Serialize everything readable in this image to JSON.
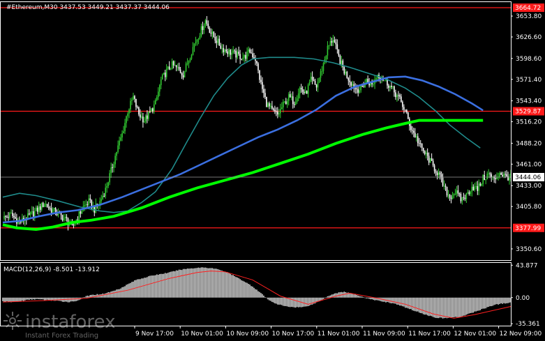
{
  "colors": {
    "background": "#000000",
    "axis": "#ffffff",
    "bull": "#32cd32",
    "bear": "#ffffff",
    "ma_fast": "#1f8b8b",
    "ma_mid": "#3b6fe0",
    "ma_slow": "#00ff00",
    "level": "#ff1a1a",
    "macd_hist": "#c8c8c8",
    "macd_signal": "#ff2020",
    "current_price_bg": "#ffffff",
    "current_price_fg": "#000000"
  },
  "header": {
    "title": "#Ethereum,M30  3437.53 3449.21 3437.37 3444.06"
  },
  "watermark": {
    "logo_icon": "instaforex-logo-icon",
    "brand": "instaforex",
    "tagline": "Instant Forex Trading"
  },
  "chart_data": [
    {
      "type": "candlestick",
      "symbol": "#Ethereum",
      "timeframe": "M30",
      "ohlc_last": {
        "open": 3437.53,
        "high": 3449.21,
        "low": 3437.37,
        "close": 3444.06
      },
      "ylim": [
        3336,
        3672
      ],
      "y_ticks": [
        "3653.80",
        "3626.60",
        "3598.60",
        "3571.40",
        "3543.40",
        "3516.20",
        "3488.20",
        "3461.00",
        "3433.00",
        "3405.80",
        "3350.60"
      ],
      "x_ticks": [
        "9 Nov 17:00",
        "10 Nov 01:00",
        "10 Nov 09:00",
        "10 Nov 17:00",
        "11 Nov 01:00",
        "11 Nov 09:00",
        "11 Nov 17:00",
        "12 Nov 01:00",
        "12 Nov 09:00"
      ],
      "levels": [
        {
          "label": "3664.72",
          "value": 3664.72
        },
        {
          "label": "3529.87",
          "value": 3529.87
        },
        {
          "label": "3377.99",
          "value": 3377.99
        }
      ],
      "current_price": {
        "label": "3444.06",
        "value": 3444.06
      },
      "close_path": [
        [
          0,
          3390
        ],
        [
          6,
          3395
        ],
        [
          12,
          3385
        ],
        [
          18,
          3392
        ],
        [
          24,
          3400
        ],
        [
          30,
          3410
        ],
        [
          34,
          3403
        ],
        [
          40,
          3396
        ],
        [
          46,
          3388
        ],
        [
          50,
          3378
        ],
        [
          54,
          3392
        ],
        [
          58,
          3405
        ],
        [
          62,
          3412
        ],
        [
          66,
          3402
        ],
        [
          70,
          3412
        ],
        [
          74,
          3428
        ],
        [
          78,
          3452
        ],
        [
          82,
          3478
        ],
        [
          86,
          3500
        ],
        [
          90,
          3530
        ],
        [
          94,
          3548
        ],
        [
          98,
          3526
        ],
        [
          102,
          3518
        ],
        [
          106,
          3528
        ],
        [
          110,
          3540
        ],
        [
          114,
          3570
        ],
        [
          118,
          3582
        ],
        [
          122,
          3590
        ],
        [
          126,
          3585
        ],
        [
          130,
          3578
        ],
        [
          134,
          3598
        ],
        [
          138,
          3618
        ],
        [
          142,
          3632
        ],
        [
          146,
          3648
        ],
        [
          150,
          3632
        ],
        [
          154,
          3622
        ],
        [
          158,
          3612
        ],
        [
          162,
          3608
        ],
        [
          166,
          3605
        ],
        [
          170,
          3602
        ],
        [
          174,
          3600
        ],
        [
          178,
          3608
        ],
        [
          182,
          3598
        ],
        [
          186,
          3565
        ],
        [
          190,
          3540
        ],
        [
          194,
          3530
        ],
        [
          198,
          3525
        ],
        [
          202,
          3538
        ],
        [
          206,
          3548
        ],
        [
          210,
          3542
        ],
        [
          214,
          3560
        ],
        [
          218,
          3552
        ],
        [
          222,
          3570
        ],
        [
          226,
          3562
        ],
        [
          230,
          3585
        ],
        [
          234,
          3612
        ],
        [
          238,
          3625
        ],
        [
          242,
          3600
        ],
        [
          246,
          3582
        ],
        [
          250,
          3570
        ],
        [
          254,
          3560
        ],
        [
          258,
          3558
        ],
        [
          262,
          3570
        ],
        [
          266,
          3564
        ],
        [
          270,
          3578
        ],
        [
          274,
          3572
        ],
        [
          278,
          3565
        ],
        [
          282,
          3555
        ],
        [
          286,
          3545
        ],
        [
          290,
          3530
        ],
        [
          294,
          3508
        ],
        [
          298,
          3495
        ],
        [
          302,
          3480
        ],
        [
          306,
          3470
        ],
        [
          310,
          3458
        ],
        [
          314,
          3448
        ],
        [
          318,
          3430
        ],
        [
          322,
          3418
        ],
        [
          326,
          3425
        ],
        [
          330,
          3415
        ],
        [
          334,
          3420
        ],
        [
          338,
          3432
        ],
        [
          342,
          3428
        ],
        [
          346,
          3442
        ],
        [
          350,
          3448
        ],
        [
          354,
          3440
        ],
        [
          358,
          3450
        ],
        [
          362,
          3445
        ],
        [
          366,
          3444
        ]
      ],
      "ma_fast": [
        [
          0,
          3418
        ],
        [
          12,
          3423
        ],
        [
          24,
          3420
        ],
        [
          40,
          3413
        ],
        [
          56,
          3405
        ],
        [
          70,
          3400
        ],
        [
          80,
          3398
        ],
        [
          90,
          3400
        ],
        [
          100,
          3411
        ],
        [
          110,
          3425
        ],
        [
          122,
          3455
        ],
        [
          132,
          3488
        ],
        [
          142,
          3520
        ],
        [
          152,
          3550
        ],
        [
          162,
          3573
        ],
        [
          172,
          3590
        ],
        [
          180,
          3598
        ],
        [
          192,
          3600
        ],
        [
          210,
          3600
        ],
        [
          224,
          3598
        ],
        [
          238,
          3593
        ],
        [
          250,
          3587
        ],
        [
          262,
          3580
        ],
        [
          276,
          3572
        ],
        [
          290,
          3560
        ],
        [
          300,
          3548
        ],
        [
          312,
          3530
        ],
        [
          322,
          3512
        ],
        [
          334,
          3495
        ],
        [
          344,
          3482
        ]
      ],
      "ma_mid": [
        [
          0,
          3385
        ],
        [
          12,
          3387
        ],
        [
          26,
          3393
        ],
        [
          40,
          3398
        ],
        [
          54,
          3401
        ],
        [
          70,
          3408
        ],
        [
          86,
          3418
        ],
        [
          100,
          3428
        ],
        [
          114,
          3438
        ],
        [
          128,
          3448
        ],
        [
          142,
          3460
        ],
        [
          156,
          3472
        ],
        [
          170,
          3484
        ],
        [
          184,
          3496
        ],
        [
          198,
          3506
        ],
        [
          212,
          3518
        ],
        [
          226,
          3532
        ],
        [
          240,
          3550
        ],
        [
          254,
          3562
        ],
        [
          266,
          3568
        ],
        [
          278,
          3574
        ],
        [
          290,
          3575
        ],
        [
          302,
          3570
        ],
        [
          314,
          3562
        ],
        [
          326,
          3552
        ],
        [
          338,
          3540
        ],
        [
          346,
          3531
        ]
      ],
      "ma_slow": [
        [
          0,
          3382
        ],
        [
          10,
          3378
        ],
        [
          24,
          3376
        ],
        [
          36,
          3379
        ],
        [
          50,
          3385
        ],
        [
          64,
          3388
        ],
        [
          80,
          3393
        ],
        [
          100,
          3404
        ],
        [
          120,
          3418
        ],
        [
          140,
          3430
        ],
        [
          160,
          3440
        ],
        [
          180,
          3450
        ],
        [
          200,
          3462
        ],
        [
          220,
          3474
        ],
        [
          240,
          3488
        ],
        [
          260,
          3500
        ],
        [
          276,
          3508
        ],
        [
          290,
          3514
        ],
        [
          300,
          3518
        ],
        [
          312,
          3518
        ],
        [
          326,
          3518
        ],
        [
          346,
          3518
        ]
      ]
    },
    {
      "type": "macd",
      "label": "MACD(12,26,9) -8.501 -13.912",
      "params": [
        12,
        26,
        9
      ],
      "macd": -8.501,
      "signal": -13.912,
      "ylim": [
        -38,
        47
      ],
      "y_ticks": [
        "43.877",
        "0.00",
        "-35.361"
      ],
      "histogram": [
        [
          0,
          -5
        ],
        [
          6,
          -6
        ],
        [
          12,
          -5
        ],
        [
          18,
          -3
        ],
        [
          24,
          -2
        ],
        [
          30,
          -3
        ],
        [
          36,
          -4
        ],
        [
          42,
          -5
        ],
        [
          48,
          -6
        ],
        [
          54,
          -4
        ],
        [
          60,
          2
        ],
        [
          66,
          4
        ],
        [
          72,
          5
        ],
        [
          78,
          8
        ],
        [
          84,
          12
        ],
        [
          90,
          18
        ],
        [
          96,
          24
        ],
        [
          102,
          27
        ],
        [
          108,
          30
        ],
        [
          114,
          32
        ],
        [
          120,
          34
        ],
        [
          126,
          37
        ],
        [
          132,
          39
        ],
        [
          138,
          40
        ],
        [
          144,
          41
        ],
        [
          150,
          40
        ],
        [
          156,
          38
        ],
        [
          162,
          34
        ],
        [
          168,
          28
        ],
        [
          174,
          22
        ],
        [
          180,
          15
        ],
        [
          186,
          6
        ],
        [
          192,
          -4
        ],
        [
          198,
          -9
        ],
        [
          204,
          -12
        ],
        [
          210,
          -13
        ],
        [
          216,
          -13
        ],
        [
          222,
          -10
        ],
        [
          228,
          -5
        ],
        [
          234,
          2
        ],
        [
          240,
          6
        ],
        [
          246,
          8
        ],
        [
          252,
          5
        ],
        [
          258,
          2
        ],
        [
          264,
          -2
        ],
        [
          270,
          -4
        ],
        [
          276,
          -6
        ],
        [
          282,
          -8
        ],
        [
          288,
          -12
        ],
        [
          294,
          -16
        ],
        [
          300,
          -20
        ],
        [
          306,
          -24
        ],
        [
          312,
          -27
        ],
        [
          318,
          -28
        ],
        [
          324,
          -27
        ],
        [
          330,
          -26
        ],
        [
          336,
          -22
        ],
        [
          342,
          -18
        ],
        [
          348,
          -14
        ],
        [
          354,
          -10
        ],
        [
          360,
          -8
        ],
        [
          366,
          -7
        ]
      ],
      "signal_line": [
        [
          0,
          -6
        ],
        [
          30,
          -4
        ],
        [
          60,
          -1
        ],
        [
          90,
          10
        ],
        [
          120,
          26
        ],
        [
          140,
          34
        ],
        [
          150,
          36
        ],
        [
          160,
          35
        ],
        [
          180,
          24
        ],
        [
          200,
          2
        ],
        [
          220,
          -9
        ],
        [
          240,
          2
        ],
        [
          250,
          6
        ],
        [
          270,
          -1
        ],
        [
          290,
          -9
        ],
        [
          310,
          -22
        ],
        [
          325,
          -28
        ],
        [
          340,
          -23
        ],
        [
          366,
          -12
        ]
      ]
    }
  ]
}
